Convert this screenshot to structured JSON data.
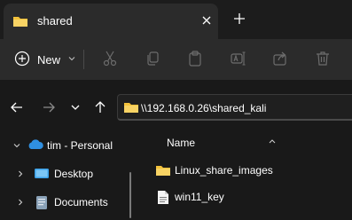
{
  "tab": {
    "title": "shared",
    "close_icon": "close-icon",
    "folder_icon": "folder-icon"
  },
  "new_tab_icon": "plus-icon",
  "toolbar": {
    "new_label": "New",
    "icons": [
      "cut-icon",
      "copy-icon",
      "paste-icon",
      "rename-icon",
      "share-icon",
      "delete-icon"
    ]
  },
  "navigation": {
    "back_icon": "arrow-left-icon",
    "forward_icon": "arrow-right-icon",
    "recent_icon": "chevron-down-icon",
    "up_icon": "arrow-up-icon"
  },
  "address": {
    "path": "\\\\192.168.0.26\\shared_kali"
  },
  "sidebar": {
    "items": [
      {
        "label": "tim - Personal",
        "icon": "onedrive-cloud-icon",
        "expanded": true
      },
      {
        "label": "Desktop",
        "icon": "desktop-icon",
        "expanded": false
      },
      {
        "label": "Documents",
        "icon": "documents-icon",
        "expanded": false
      }
    ]
  },
  "content": {
    "column_header": "Name",
    "sort_icon": "chevron-up-icon",
    "items": [
      {
        "name": "Linux_share_images",
        "type": "folder"
      },
      {
        "name": "win11_key",
        "type": "file"
      }
    ]
  },
  "colors": {
    "folder": "#f3c13a",
    "background": "#191919",
    "toolbar": "#2b2b2b",
    "cloud": "#2f8fe0"
  }
}
